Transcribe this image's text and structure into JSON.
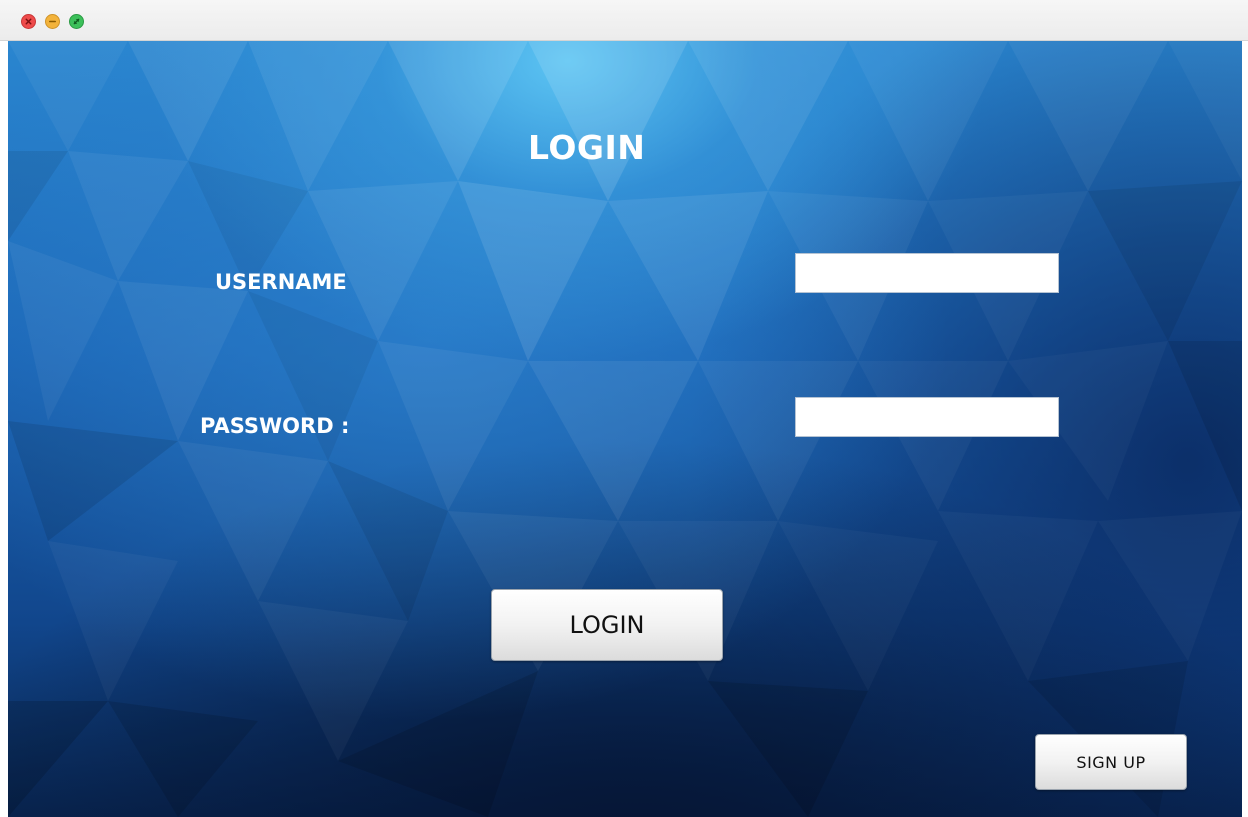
{
  "window": {
    "controls": {
      "close_icon": "close-icon",
      "minimize_icon": "minimize-icon",
      "maximize_icon": "maximize-icon"
    }
  },
  "form": {
    "title": "LOGIN",
    "username_label": "USERNAME",
    "username_value": "",
    "password_label": "PASSWORD :",
    "password_value": "",
    "login_button_label": "LOGIN",
    "signup_button_label": "SIGN UP"
  },
  "colors": {
    "close": "#ee4b4b",
    "minimize": "#f3b33b",
    "maximize": "#3cc05a",
    "background_top": "#2a86d0",
    "background_bottom": "#08244f",
    "text": "#ffffff"
  }
}
